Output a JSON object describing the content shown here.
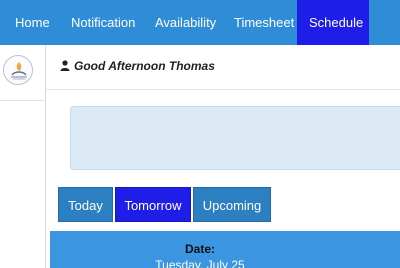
{
  "nav": {
    "items": [
      {
        "label": "Home",
        "active": false
      },
      {
        "label": "Notification",
        "active": false
      },
      {
        "label": "Availability",
        "active": false
      },
      {
        "label": "Timesheet",
        "active": false
      },
      {
        "label": "Schedule",
        "active": true
      }
    ]
  },
  "greeting": "Good Afternoon Thomas",
  "tabs": [
    {
      "label": "Today",
      "selected": false
    },
    {
      "label": "Tomorrow",
      "selected": true
    },
    {
      "label": "Upcoming",
      "selected": false
    }
  ],
  "date_panel": {
    "label": "Date:",
    "value": "Tuesday, July 25"
  },
  "colors": {
    "nav_bg": "#2f8dd8",
    "nav_active": "#1f1ee8",
    "tab_bg": "#2c7fc1",
    "tab_selected": "#1f1ee8",
    "info_panel": "#dceaf6",
    "date_panel": "#3b95e0"
  },
  "icons": {
    "greeting_icon": "user-icon",
    "logo": "app-logo"
  }
}
